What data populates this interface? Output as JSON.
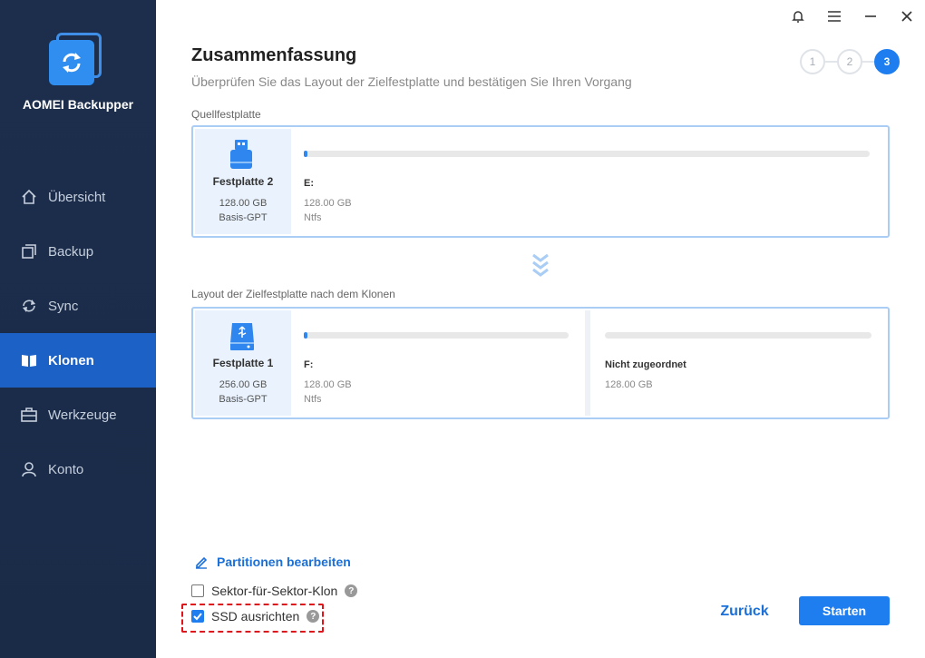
{
  "app": {
    "name": "AOMEI Backupper"
  },
  "sidebar": {
    "items": [
      {
        "label": "Übersicht",
        "icon": "home-icon"
      },
      {
        "label": "Backup",
        "icon": "backup-icon"
      },
      {
        "label": "Sync",
        "icon": "sync-icon"
      },
      {
        "label": "Klonen",
        "icon": "clone-icon",
        "active": true
      },
      {
        "label": "Werkzeuge",
        "icon": "toolbox-icon"
      },
      {
        "label": "Konto",
        "icon": "user-icon"
      }
    ]
  },
  "window_controls": [
    "bell-icon",
    "menu-icon",
    "minimize-icon",
    "close-icon"
  ],
  "header": {
    "title": "Zusammenfassung",
    "subtitle": "Überprüfen Sie das Layout der Zielfestplatte und bestätigen Sie Ihren Vorgang"
  },
  "steps": {
    "items": [
      "1",
      "2",
      "3"
    ],
    "current": "3"
  },
  "source": {
    "section_label": "Quellfestplatte",
    "disk": {
      "name": "Festplatte 2",
      "size": "128.00 GB",
      "type": "Basis-GPT",
      "icon": "usb-drive-icon"
    },
    "partitions": [
      {
        "letter": "E:",
        "size": "128.00 GB",
        "fs": "Ntfs",
        "used_fraction": 0.01
      }
    ]
  },
  "target": {
    "section_label": "Layout der Zielfestplatte nach dem Klonen",
    "disk": {
      "name": "Festplatte 1",
      "size": "256.00 GB",
      "type": "Basis-GPT",
      "icon": "usb-disk-icon"
    },
    "partitions": [
      {
        "letter": "F:",
        "size": "128.00 GB",
        "fs": "Ntfs",
        "used_fraction": 0.01
      },
      {
        "letter": "Nicht zugeordnet",
        "size": "128.00 GB",
        "used_fraction": 0
      }
    ]
  },
  "options": {
    "edit_partitions": "Partitionen bearbeiten",
    "sector_clone": {
      "label": "Sektor-für-Sektor-Klon",
      "checked": false
    },
    "ssd_align": {
      "label": "SSD ausrichten",
      "checked": true
    },
    "help_glyph": "?"
  },
  "buttons": {
    "back": "Zurück",
    "start": "Starten"
  },
  "colors": {
    "accent": "#1e7ef0",
    "sidebar": "#1c2e4c",
    "highlight": "#e0141b"
  }
}
